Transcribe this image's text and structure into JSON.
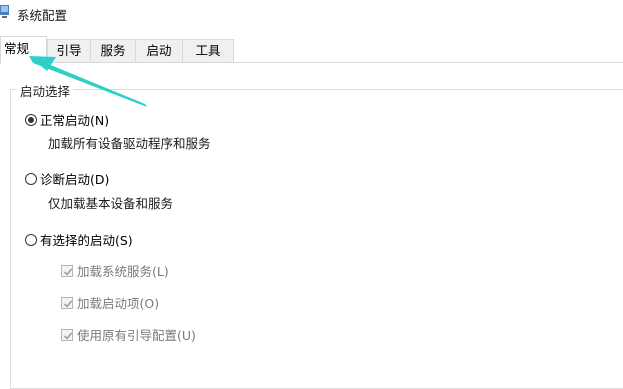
{
  "window": {
    "title": "系统配置",
    "icon": "system-config-icon"
  },
  "tabs": [
    {
      "label": "常规",
      "active": true
    },
    {
      "label": "引导",
      "active": false
    },
    {
      "label": "服务",
      "active": false
    },
    {
      "label": "启动",
      "active": false
    },
    {
      "label": "工具",
      "active": false
    }
  ],
  "startup_group": {
    "legend": "启动选择",
    "options": [
      {
        "label": "正常启动(N)",
        "checked": true,
        "description": "加载所有设备驱动程序和服务"
      },
      {
        "label": "诊断启动(D)",
        "checked": false,
        "description": "仅加载基本设备和服务"
      },
      {
        "label": "有选择的启动(S)",
        "checked": false,
        "description": ""
      }
    ],
    "selective_items": [
      {
        "label": "加载系统服务(L)",
        "checked": true,
        "enabled": false
      },
      {
        "label": "加载启动项(O)",
        "checked": true,
        "enabled": false
      },
      {
        "label": "使用原有引导配置(U)",
        "checked": true,
        "enabled": false
      }
    ]
  },
  "colors": {
    "annotation_arrow": "#2fcfc9"
  }
}
